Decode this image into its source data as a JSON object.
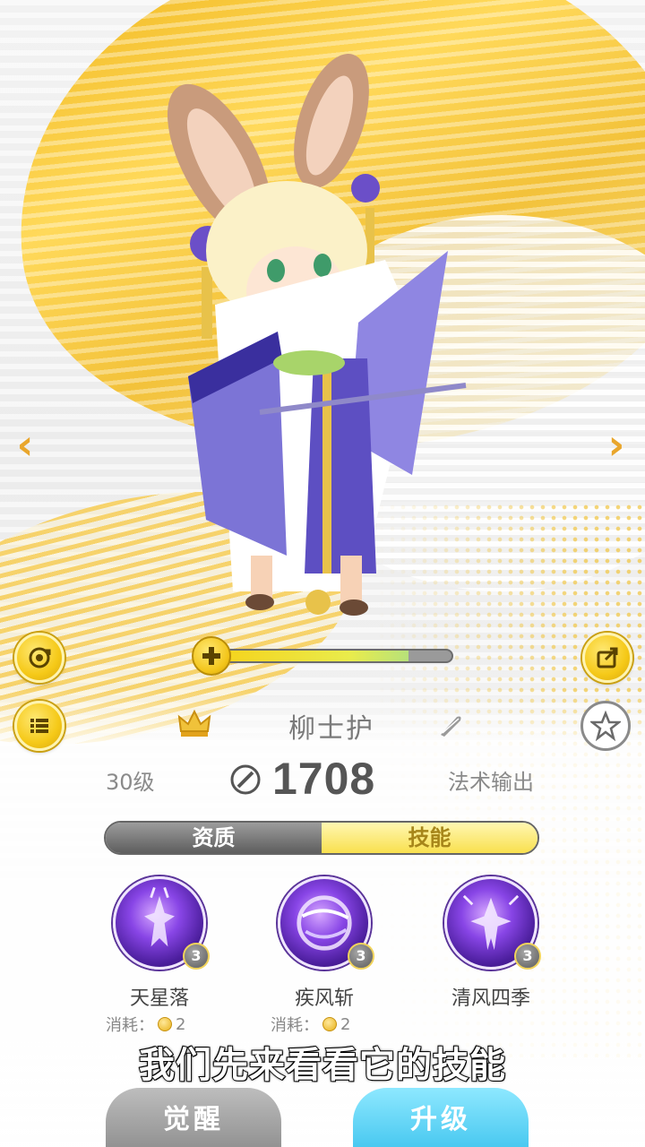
{
  "character": {
    "name": "柳士护",
    "level": "30级",
    "power": "1708",
    "role": "法术输出"
  },
  "exp": {
    "progress": 0.82
  },
  "tabs": [
    {
      "label": "资质",
      "active": false
    },
    {
      "label": "技能",
      "active": true
    }
  ],
  "skills": [
    {
      "name": "天星落",
      "level": "3"
    },
    {
      "name": "疾风斩",
      "level": "3"
    },
    {
      "name": "清风四季",
      "level": "3"
    }
  ],
  "costs": [
    {
      "label": "消耗：",
      "value": "2"
    },
    {
      "label": "消耗：",
      "value": "2"
    }
  ],
  "subtitle": "我们先来看看它的技能",
  "buttons": {
    "awaken": "觉醒",
    "upgrade": "升级"
  },
  "icons": {
    "reset": "refresh-icon",
    "list": "list-icon",
    "share": "share-icon",
    "star": "star-icon",
    "crown": "crown-icon",
    "feather": "feather-icon",
    "power": "power-icon",
    "plus": "plus-icon"
  },
  "colors": {
    "accent_gold": "#f5c918",
    "skill_purple": "#8845e6",
    "upgrade_blue": "#3fc4ee"
  }
}
